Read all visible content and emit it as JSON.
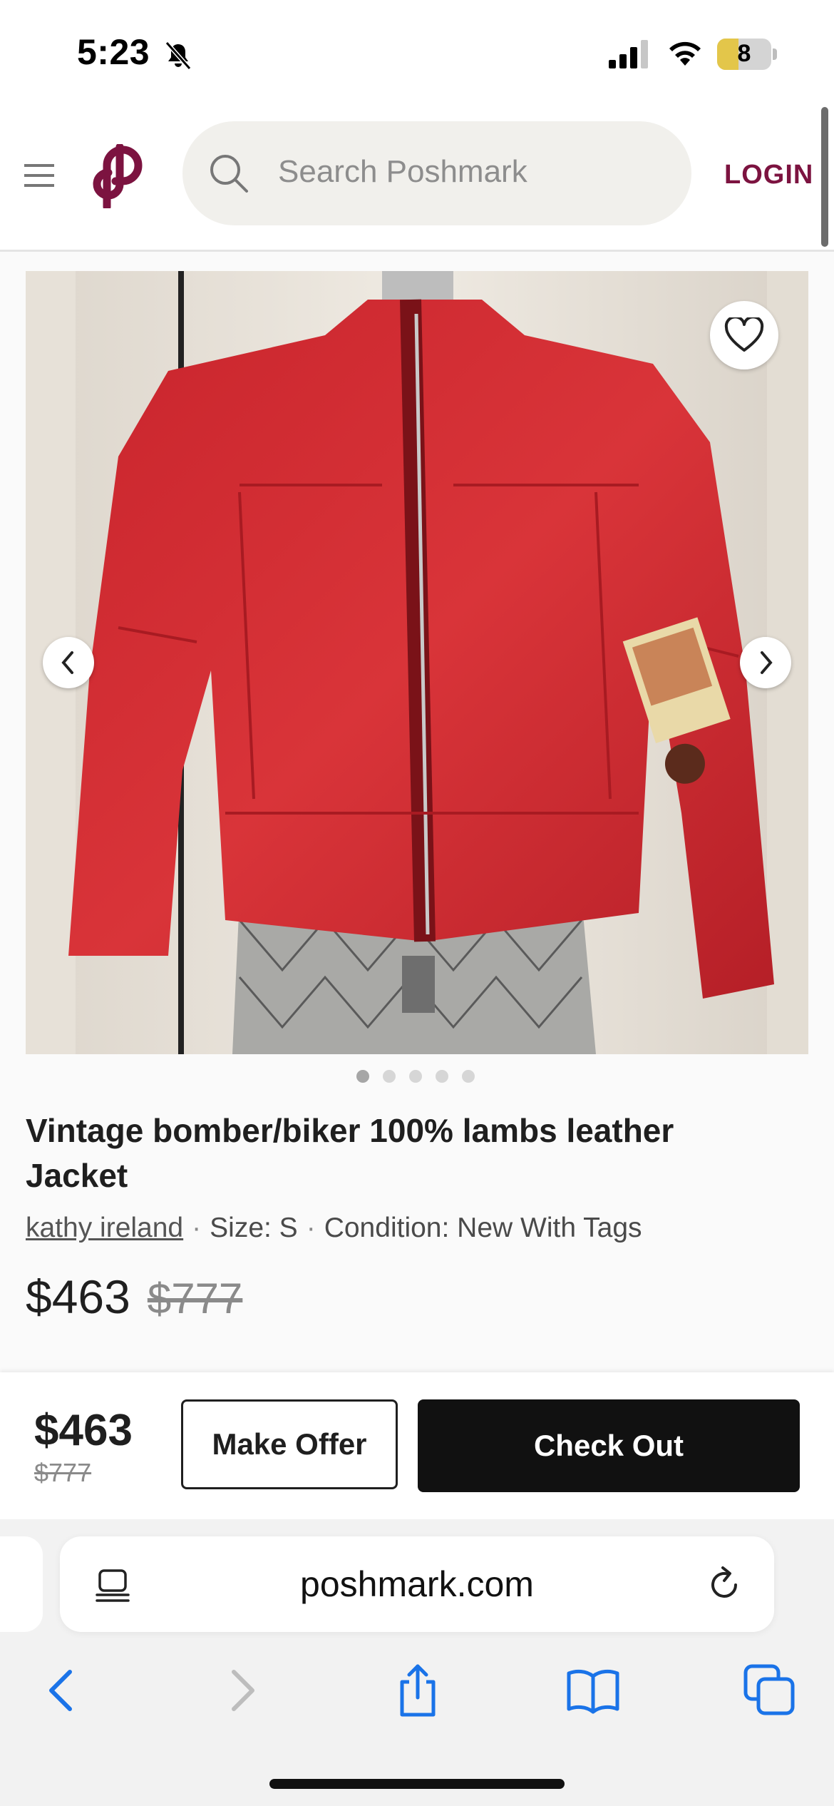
{
  "status_bar": {
    "time": "5:23",
    "battery": "8"
  },
  "header": {
    "search_placeholder": "Search Poshmark",
    "login_label": "LOGIN"
  },
  "product": {
    "title": "Vintage bomber/biker 100% lambs leather Jacket",
    "brand": "kathy ireland",
    "size": "Size: S",
    "condition": "Condition: New With Tags",
    "price": "$463",
    "original_price": "$777",
    "image_count": 5,
    "active_image": 1
  },
  "buy_bar": {
    "price": "$463",
    "original_price": "$777",
    "make_offer_label": "Make Offer",
    "checkout_label": "Check Out"
  },
  "browser": {
    "url": "poshmark.com"
  },
  "colors": {
    "brand": "#7c1340",
    "checkout_bg": "#111111",
    "browser_blue": "#1a73e8"
  }
}
